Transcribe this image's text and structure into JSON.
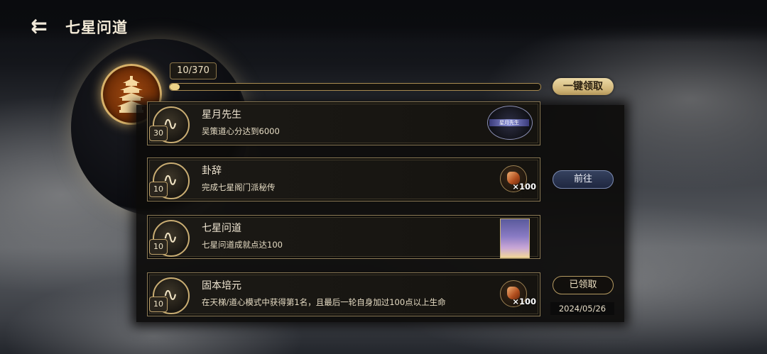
{
  "header": {
    "title": "七星问道",
    "back_icon": "back-arrow-icon"
  },
  "progress": {
    "text": "10/370",
    "current": 10,
    "total": 370
  },
  "actions": {
    "claim_all": "一键领取",
    "go": "前往",
    "claimed": "已领取"
  },
  "colors": {
    "gold": "#d8b26a",
    "panel": "#15130f",
    "accent_blue": "#35415e"
  },
  "tasks": [
    {
      "level": "30",
      "name": "星月先生",
      "desc": "吴策道心分达到6000",
      "reward_label": "星月先生"
    },
    {
      "level": "10",
      "name": "卦辞",
      "desc": "完成七星阁门派秘传",
      "reward_qty": "×100"
    },
    {
      "level": "10",
      "name": "七星问道",
      "desc": "七星问道成就点达100"
    },
    {
      "level": "10",
      "name": "固本培元",
      "desc": "在天梯/道心模式中获得第1名，且最后一轮自身加过100点以上生命",
      "reward_qty": "×100",
      "date": "2024/05/26"
    }
  ]
}
